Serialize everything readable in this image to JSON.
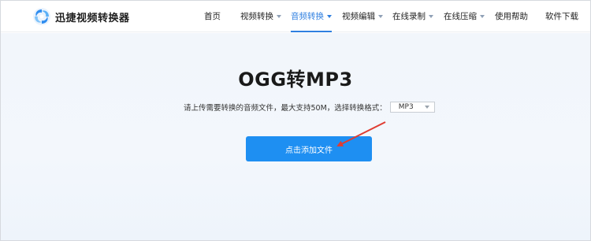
{
  "header": {
    "brand": "迅捷视频转换器",
    "logo_icon": "swirl-logo-icon",
    "nav": [
      {
        "label": "首页",
        "has_menu": false,
        "active": false
      },
      {
        "label": "视频转换",
        "has_menu": true,
        "active": false
      },
      {
        "label": "音频转换",
        "has_menu": true,
        "active": true
      },
      {
        "label": "视频编辑",
        "has_menu": true,
        "active": false
      },
      {
        "label": "在线录制",
        "has_menu": true,
        "active": false
      },
      {
        "label": "在线压缩",
        "has_menu": true,
        "active": false
      },
      {
        "label": "使用帮助",
        "has_menu": false,
        "active": false
      },
      {
        "label": "软件下载",
        "has_menu": false,
        "active": false
      }
    ]
  },
  "main": {
    "title": "OGG转MP3",
    "description": "请上传需要转换的音频文件，最大支持50M，选择转换格式：",
    "format_select": {
      "value": "MP3"
    },
    "upload_button": "点击添加文件"
  },
  "colors": {
    "accent": "#2f7fe0",
    "button": "#1e8ff2",
    "annotation_arrow": "#e03c31"
  }
}
